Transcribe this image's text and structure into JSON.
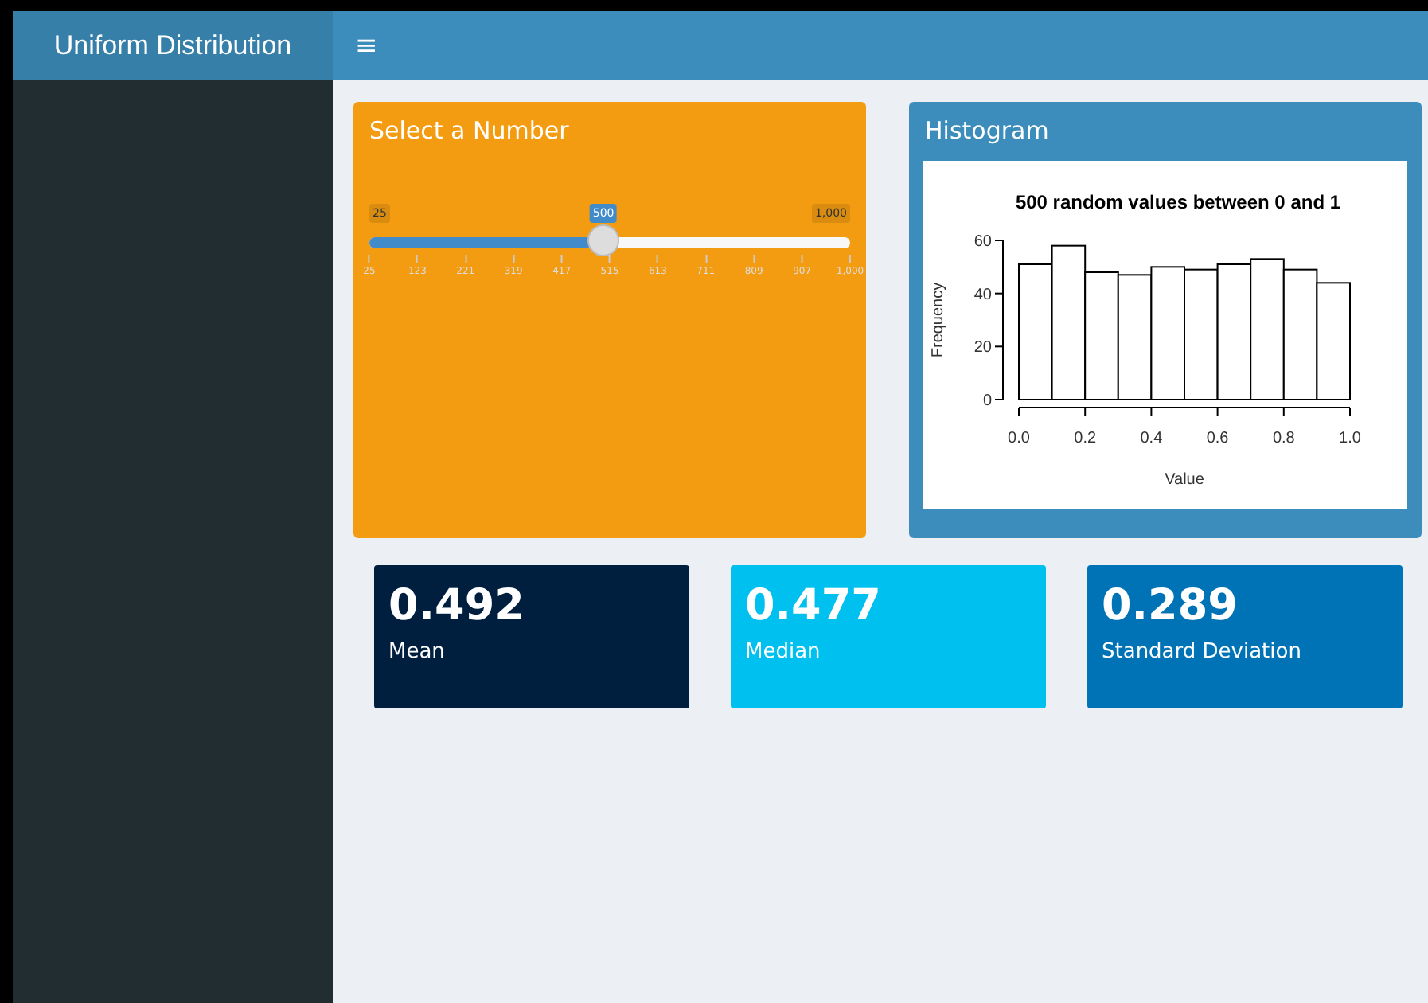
{
  "header": {
    "title": "Uniform Distribution",
    "menu_icon": "≡"
  },
  "slider_box": {
    "title": "Select a Number",
    "min_label": "25",
    "max_label": "1,000",
    "value_label": "500",
    "level": 0.487,
    "ticks": [
      "25",
      "123",
      "221",
      "319",
      "417",
      "515",
      "613",
      "711",
      "809",
      "907",
      "1,000"
    ]
  },
  "histogram_box": {
    "title": "Histogram",
    "chart_data": {
      "type": "bar",
      "title": "500 random values between 0 and 1",
      "xlabel": "Value",
      "ylabel": "Frequency",
      "x": [
        0.05,
        0.15,
        0.25,
        0.35,
        0.45,
        0.55,
        0.65,
        0.75,
        0.85,
        0.95
      ],
      "values": [
        51,
        58,
        48,
        47,
        50,
        49,
        51,
        53,
        49,
        44
      ],
      "xticks": [
        {
          "value": 0,
          "label": "0.0"
        },
        {
          "value": 0.2,
          "label": "0.2"
        },
        {
          "value": 0.4,
          "label": "0.4"
        },
        {
          "value": 0.6,
          "label": "0.6"
        },
        {
          "value": 0.8,
          "label": "0.8"
        },
        {
          "value": 1,
          "label": "1.0"
        }
      ],
      "yticks": [
        0,
        20,
        40,
        60
      ],
      "xlim": [
        0,
        1
      ],
      "ylim": [
        0,
        60
      ]
    }
  },
  "value_boxes": [
    {
      "value": "0.492",
      "label": "Mean",
      "color": "#001f3f"
    },
    {
      "value": "0.477",
      "label": "Median",
      "color": "#00c0ef"
    },
    {
      "value": "0.289",
      "label": "Standard Deviation",
      "color": "#0073b7"
    }
  ]
}
